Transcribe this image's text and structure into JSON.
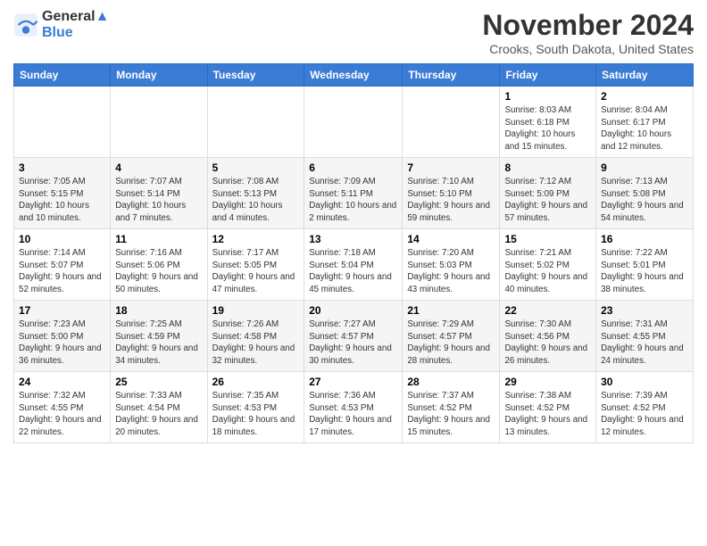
{
  "logo": {
    "line1": "General",
    "line2": "Blue"
  },
  "title": "November 2024",
  "location": "Crooks, South Dakota, United States",
  "weekdays": [
    "Sunday",
    "Monday",
    "Tuesday",
    "Wednesday",
    "Thursday",
    "Friday",
    "Saturday"
  ],
  "weeks": [
    [
      {
        "day": "",
        "info": ""
      },
      {
        "day": "",
        "info": ""
      },
      {
        "day": "",
        "info": ""
      },
      {
        "day": "",
        "info": ""
      },
      {
        "day": "",
        "info": ""
      },
      {
        "day": "1",
        "info": "Sunrise: 8:03 AM\nSunset: 6:18 PM\nDaylight: 10 hours and 15 minutes."
      },
      {
        "day": "2",
        "info": "Sunrise: 8:04 AM\nSunset: 6:17 PM\nDaylight: 10 hours and 12 minutes."
      }
    ],
    [
      {
        "day": "3",
        "info": "Sunrise: 7:05 AM\nSunset: 5:15 PM\nDaylight: 10 hours and 10 minutes."
      },
      {
        "day": "4",
        "info": "Sunrise: 7:07 AM\nSunset: 5:14 PM\nDaylight: 10 hours and 7 minutes."
      },
      {
        "day": "5",
        "info": "Sunrise: 7:08 AM\nSunset: 5:13 PM\nDaylight: 10 hours and 4 minutes."
      },
      {
        "day": "6",
        "info": "Sunrise: 7:09 AM\nSunset: 5:11 PM\nDaylight: 10 hours and 2 minutes."
      },
      {
        "day": "7",
        "info": "Sunrise: 7:10 AM\nSunset: 5:10 PM\nDaylight: 9 hours and 59 minutes."
      },
      {
        "day": "8",
        "info": "Sunrise: 7:12 AM\nSunset: 5:09 PM\nDaylight: 9 hours and 57 minutes."
      },
      {
        "day": "9",
        "info": "Sunrise: 7:13 AM\nSunset: 5:08 PM\nDaylight: 9 hours and 54 minutes."
      }
    ],
    [
      {
        "day": "10",
        "info": "Sunrise: 7:14 AM\nSunset: 5:07 PM\nDaylight: 9 hours and 52 minutes."
      },
      {
        "day": "11",
        "info": "Sunrise: 7:16 AM\nSunset: 5:06 PM\nDaylight: 9 hours and 50 minutes."
      },
      {
        "day": "12",
        "info": "Sunrise: 7:17 AM\nSunset: 5:05 PM\nDaylight: 9 hours and 47 minutes."
      },
      {
        "day": "13",
        "info": "Sunrise: 7:18 AM\nSunset: 5:04 PM\nDaylight: 9 hours and 45 minutes."
      },
      {
        "day": "14",
        "info": "Sunrise: 7:20 AM\nSunset: 5:03 PM\nDaylight: 9 hours and 43 minutes."
      },
      {
        "day": "15",
        "info": "Sunrise: 7:21 AM\nSunset: 5:02 PM\nDaylight: 9 hours and 40 minutes."
      },
      {
        "day": "16",
        "info": "Sunrise: 7:22 AM\nSunset: 5:01 PM\nDaylight: 9 hours and 38 minutes."
      }
    ],
    [
      {
        "day": "17",
        "info": "Sunrise: 7:23 AM\nSunset: 5:00 PM\nDaylight: 9 hours and 36 minutes."
      },
      {
        "day": "18",
        "info": "Sunrise: 7:25 AM\nSunset: 4:59 PM\nDaylight: 9 hours and 34 minutes."
      },
      {
        "day": "19",
        "info": "Sunrise: 7:26 AM\nSunset: 4:58 PM\nDaylight: 9 hours and 32 minutes."
      },
      {
        "day": "20",
        "info": "Sunrise: 7:27 AM\nSunset: 4:57 PM\nDaylight: 9 hours and 30 minutes."
      },
      {
        "day": "21",
        "info": "Sunrise: 7:29 AM\nSunset: 4:57 PM\nDaylight: 9 hours and 28 minutes."
      },
      {
        "day": "22",
        "info": "Sunrise: 7:30 AM\nSunset: 4:56 PM\nDaylight: 9 hours and 26 minutes."
      },
      {
        "day": "23",
        "info": "Sunrise: 7:31 AM\nSunset: 4:55 PM\nDaylight: 9 hours and 24 minutes."
      }
    ],
    [
      {
        "day": "24",
        "info": "Sunrise: 7:32 AM\nSunset: 4:55 PM\nDaylight: 9 hours and 22 minutes."
      },
      {
        "day": "25",
        "info": "Sunrise: 7:33 AM\nSunset: 4:54 PM\nDaylight: 9 hours and 20 minutes."
      },
      {
        "day": "26",
        "info": "Sunrise: 7:35 AM\nSunset: 4:53 PM\nDaylight: 9 hours and 18 minutes."
      },
      {
        "day": "27",
        "info": "Sunrise: 7:36 AM\nSunset: 4:53 PM\nDaylight: 9 hours and 17 minutes."
      },
      {
        "day": "28",
        "info": "Sunrise: 7:37 AM\nSunset: 4:52 PM\nDaylight: 9 hours and 15 minutes."
      },
      {
        "day": "29",
        "info": "Sunrise: 7:38 AM\nSunset: 4:52 PM\nDaylight: 9 hours and 13 minutes."
      },
      {
        "day": "30",
        "info": "Sunrise: 7:39 AM\nSunset: 4:52 PM\nDaylight: 9 hours and 12 minutes."
      }
    ]
  ]
}
